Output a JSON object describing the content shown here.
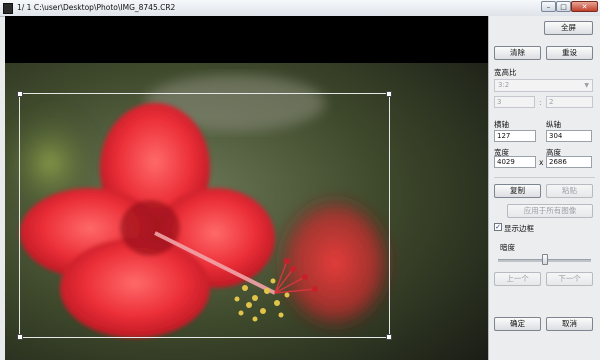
{
  "window": {
    "title": "1/  1  C:\\user\\Desktop\\Photo\\IMG_8745.CR2",
    "min_glyph": "–",
    "max_glyph": "□",
    "close_glyph": "✕"
  },
  "panel": {
    "fullscreen_label": "全屏",
    "clear_label": "清除",
    "reset_label": "重设",
    "aspect_ratio_label": "宽高比",
    "aspect_ratio_value": "3:2",
    "ratio_w": "3",
    "ratio_sep": ":",
    "ratio_h": "2",
    "x_axis_label": "横轴",
    "y_axis_label": "纵轴",
    "x_axis_value": "127",
    "y_axis_value": "304",
    "width_label": "宽度",
    "height_label": "高度",
    "width_value": "4029",
    "times": "x",
    "height_value": "2686",
    "copy_label": "复制",
    "paste_label": "粘贴",
    "apply_all_label": "应用于所有图像",
    "show_frame_label": "显示边框",
    "show_frame_checked": true,
    "darkness_label": "暗度",
    "darkness_level": 0.5,
    "prev_label": "上一个",
    "next_label": "下一个",
    "ok_label": "确定",
    "cancel_label": "取消"
  },
  "colors": {
    "flower_red": "#e8303a",
    "stamen_yellow": "#e2c44a",
    "background_green": "#4f6b2a"
  }
}
